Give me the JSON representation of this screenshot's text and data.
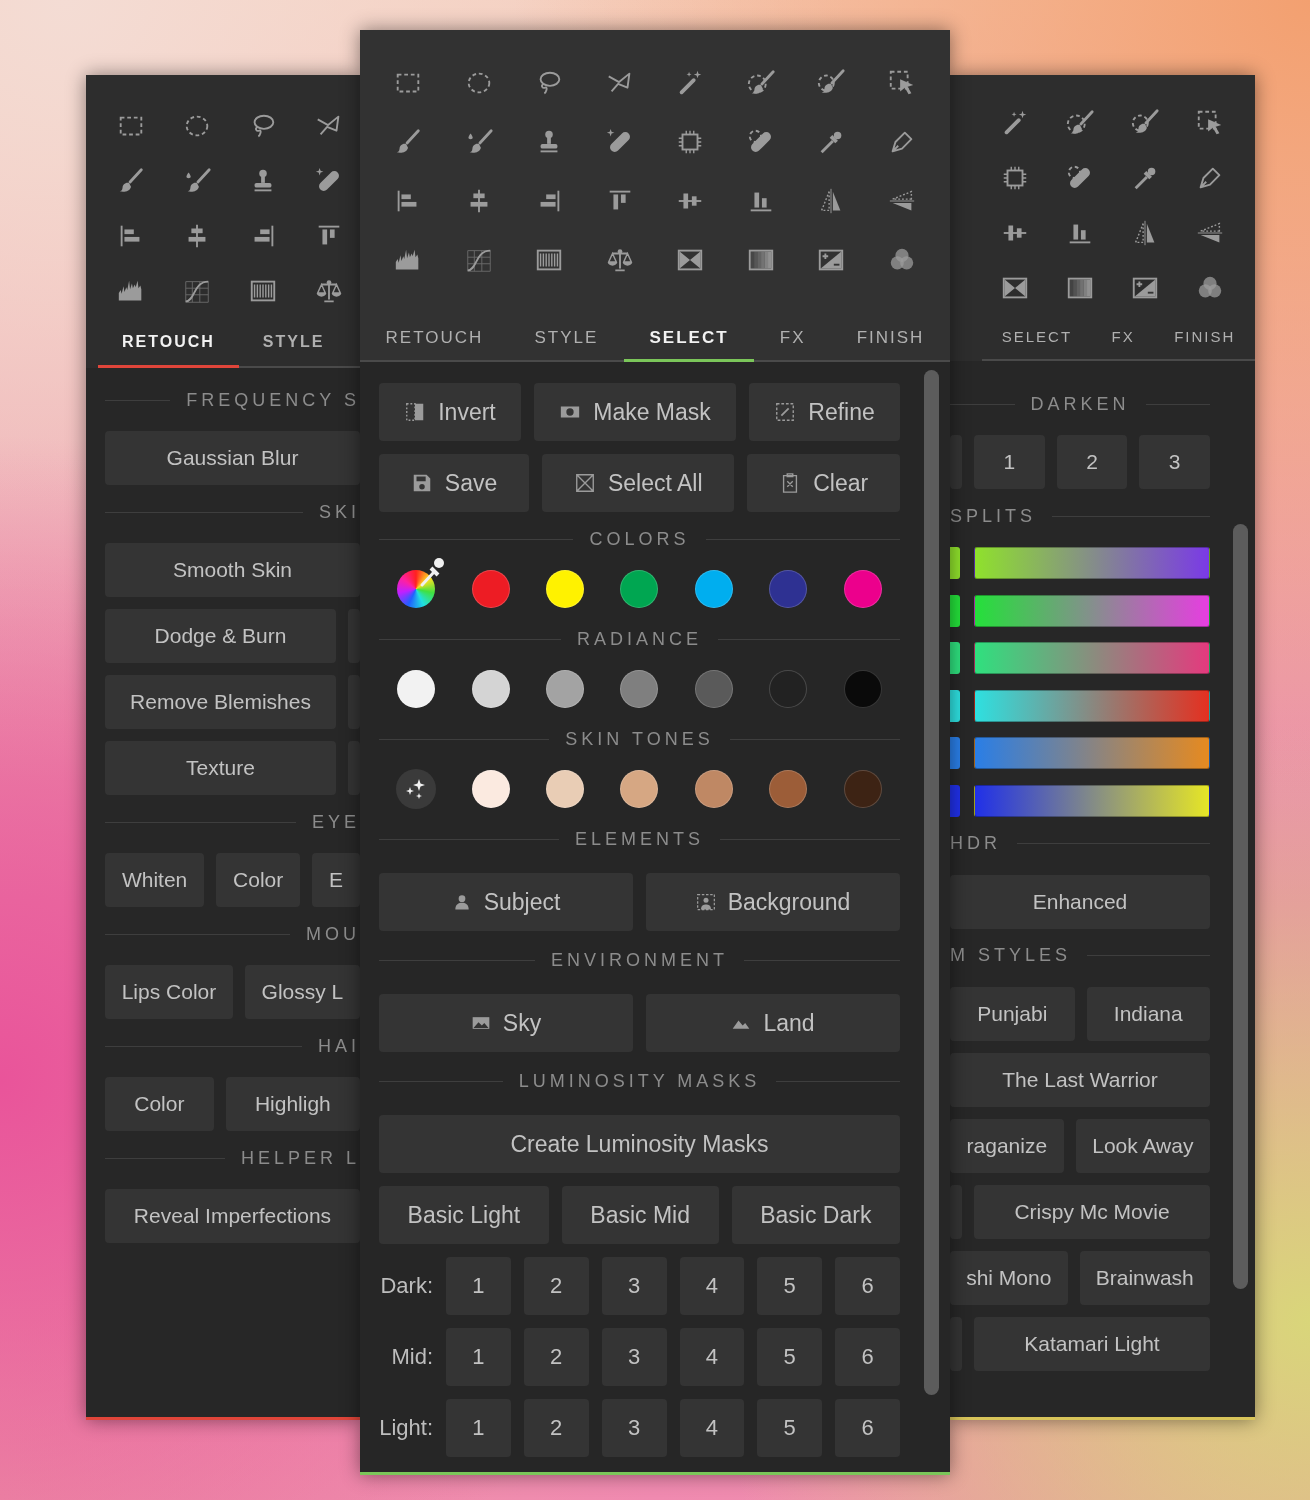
{
  "left_panel": {
    "tabs": [
      {
        "label": "RETOUCH",
        "selected": true
      },
      {
        "label": "STYLE",
        "selected": false
      }
    ],
    "sections": [
      {
        "title": "FREQUENCY S",
        "kind": "cut",
        "rows": [
          [
            {
              "kind": "button",
              "label": "Gaussian Blur"
            }
          ]
        ]
      },
      {
        "title": "SKI",
        "kind": "cut",
        "rows": [
          [
            {
              "kind": "button",
              "label": "Smooth Skin"
            }
          ],
          [
            {
              "kind": "button",
              "label": "Dodge & Burn"
            },
            {
              "kind": "stub"
            }
          ],
          [
            {
              "kind": "button",
              "label": "Remove Blemishes"
            },
            {
              "kind": "stub"
            }
          ],
          [
            {
              "kind": "button",
              "label": "Texture"
            },
            {
              "kind": "stub"
            }
          ]
        ]
      },
      {
        "title": "EYE",
        "kind": "cut",
        "rows": [
          [
            {
              "kind": "button",
              "label": "Whiten"
            },
            {
              "kind": "button",
              "label": "Color"
            },
            {
              "kind": "button",
              "label": "E"
            }
          ]
        ]
      },
      {
        "title": "MOU",
        "kind": "cut",
        "rows": [
          [
            {
              "kind": "button",
              "label": "Lips Color"
            },
            {
              "kind": "button",
              "label": "Glossy L"
            }
          ]
        ]
      },
      {
        "title": "HAI",
        "kind": "cut",
        "rows": [
          [
            {
              "kind": "button",
              "label": "Color"
            },
            {
              "kind": "button",
              "label": "Highligh"
            }
          ]
        ]
      },
      {
        "title": "HELPER L",
        "kind": "cut",
        "rows": [
          [
            {
              "kind": "button",
              "label": "Reveal Imperfections"
            }
          ]
        ]
      }
    ]
  },
  "center_panel": {
    "tabs": [
      {
        "label": "RETOUCH",
        "selected": false
      },
      {
        "label": "STYLE",
        "selected": false
      },
      {
        "label": "SELECT",
        "selected": true
      },
      {
        "label": "FX",
        "selected": false
      },
      {
        "label": "FINISH",
        "selected": false
      }
    ],
    "action_rows": [
      [
        "Invert",
        "Make Mask",
        "Refine"
      ],
      [
        "Save",
        "Select All",
        "Clear"
      ]
    ],
    "swatch_groups": [
      {
        "title": "COLORS",
        "swatches": [
          {
            "kind": "picker"
          },
          {
            "kind": "swatch",
            "color": "#ed1c24"
          },
          {
            "kind": "swatch",
            "color": "#fff200"
          },
          {
            "kind": "swatch",
            "color": "#00a651"
          },
          {
            "kind": "swatch",
            "color": "#00aeef"
          },
          {
            "kind": "swatch",
            "color": "#2e3192"
          },
          {
            "kind": "swatch",
            "color": "#ec008c"
          }
        ]
      },
      {
        "title": "RADIANCE",
        "swatches": [
          {
            "kind": "swatch",
            "color": "#f2f2f2"
          },
          {
            "kind": "swatch",
            "color": "#d4d4d4"
          },
          {
            "kind": "swatch",
            "color": "#a3a3a3"
          },
          {
            "kind": "swatch",
            "color": "#7f7f7f"
          },
          {
            "kind": "swatch",
            "color": "#5a5a5a"
          },
          {
            "kind": "swatch",
            "color": "#222222"
          },
          {
            "kind": "swatch",
            "color": "#0a0a0a"
          }
        ]
      },
      {
        "title": "SKIN TONES",
        "swatches": [
          {
            "kind": "auto"
          },
          {
            "kind": "swatch",
            "color": "#fbeae0"
          },
          {
            "kind": "swatch",
            "color": "#e9cdb5"
          },
          {
            "kind": "swatch",
            "color": "#d6a783"
          },
          {
            "kind": "swatch",
            "color": "#bf8864"
          },
          {
            "kind": "swatch",
            "color": "#9c5d38"
          },
          {
            "kind": "swatch",
            "color": "#3d2314"
          }
        ]
      }
    ],
    "button_groups": [
      {
        "title": "ELEMENTS",
        "buttons": [
          "Subject",
          "Background"
        ]
      },
      {
        "title": "ENVIRONMENT",
        "buttons": [
          "Sky",
          "Land"
        ]
      }
    ],
    "luminosity": {
      "title": "LUMINOSITY MASKS",
      "create": "Create Luminosity Masks",
      "basics": [
        "Basic Light",
        "Basic Mid",
        "Basic Dark"
      ],
      "levels": [
        {
          "label": "Dark:",
          "buttons": [
            "1",
            "2",
            "3",
            "4",
            "5",
            "6"
          ]
        },
        {
          "label": "Mid:",
          "buttons": [
            "1",
            "2",
            "3",
            "4",
            "5",
            "6"
          ]
        },
        {
          "label": "Light:",
          "buttons": [
            "1",
            "2",
            "3",
            "4",
            "5",
            "6"
          ]
        }
      ]
    }
  },
  "right_panel": {
    "tabs": [
      {
        "label": "SELECT",
        "selected": false
      },
      {
        "label": "FX",
        "selected": false
      },
      {
        "label": "FINISH",
        "selected": false
      }
    ],
    "sections": [
      {
        "title": "DARKEN",
        "kind": "centered",
        "rows": [
          [
            {
              "kind": "stub"
            },
            {
              "kind": "button",
              "label": "1"
            },
            {
              "kind": "button",
              "label": "2"
            },
            {
              "kind": "button",
              "label": "3"
            }
          ]
        ]
      },
      {
        "title": "SPLITS",
        "kind": "cut",
        "splits": [
          {
            "stops": [
              {
                "color": "#8fe12c"
              },
              {
                "color": "#7a3ae6"
              }
            ]
          },
          {
            "stops": [
              {
                "color": "#24e03a"
              },
              {
                "color": "#e63ee0"
              }
            ]
          },
          {
            "stops": [
              {
                "color": "#2fe07e"
              },
              {
                "color": "#e43a7e"
              }
            ]
          },
          {
            "stops": [
              {
                "color": "#2ee0e0"
              },
              {
                "color": "#e43020"
              }
            ]
          },
          {
            "stops": [
              {
                "color": "#2a7ee6"
              },
              {
                "color": "#e68a20"
              }
            ]
          },
          {
            "stops": [
              {
                "color": "#2030e8"
              },
              {
                "color": "#e6e626"
              }
            ]
          }
        ]
      },
      {
        "title": "HDR",
        "kind": "cut",
        "rows": [
          [
            {
              "kind": "button",
              "label": "Enhanced"
            }
          ]
        ]
      },
      {
        "title": "M STYLES",
        "kind": "cut",
        "rows": [
          [
            {
              "kind": "button",
              "label": "Punjabi"
            },
            {
              "kind": "button",
              "label": "Indiana"
            }
          ],
          [
            {
              "kind": "button",
              "label": "The Last Warrior"
            }
          ],
          [
            {
              "kind": "button",
              "label": "raganize"
            },
            {
              "kind": "button",
              "label": "Look Away"
            }
          ],
          [
            {
              "kind": "stub"
            },
            {
              "kind": "button",
              "label": "Crispy Mc Movie"
            }
          ],
          [
            {
              "kind": "button",
              "label": "shi Mono"
            },
            {
              "kind": "button",
              "label": "Brainwash"
            }
          ],
          [
            {
              "kind": "stub"
            },
            {
              "kind": "button",
              "label": "Katamari Light"
            }
          ]
        ]
      }
    ]
  }
}
